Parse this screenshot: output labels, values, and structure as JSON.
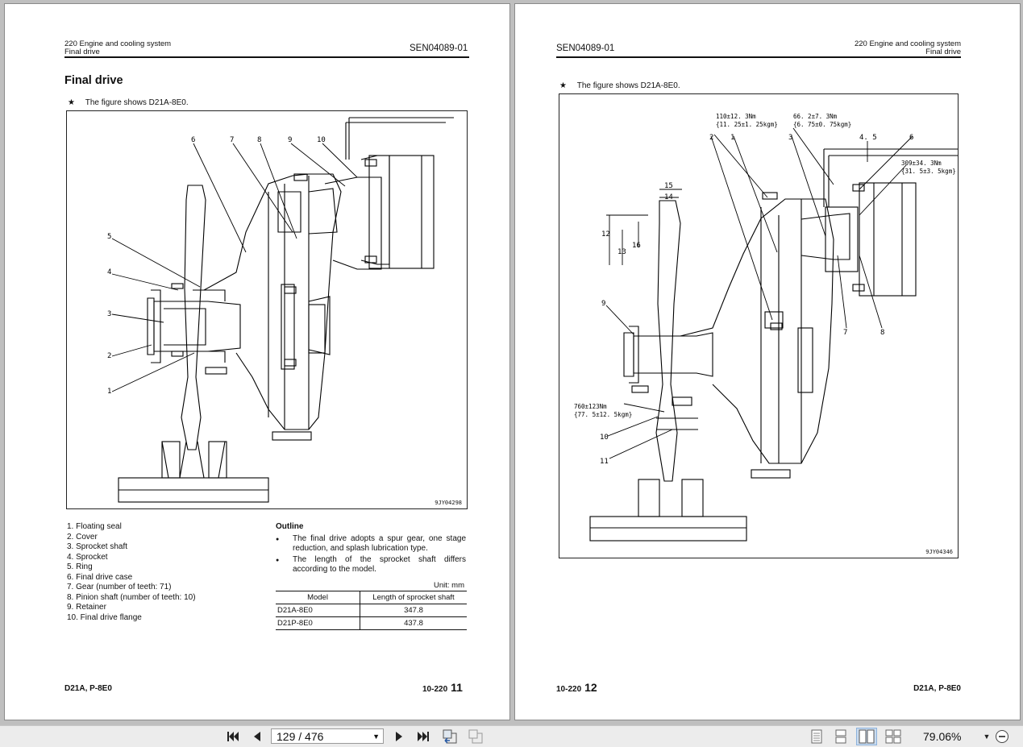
{
  "left_page": {
    "header_line1": "220 Engine and cooling system",
    "header_line2": "Final drive",
    "doc_code": "SEN04089-01",
    "title": "Final drive",
    "note_star": "★",
    "note": "The figure shows D21A-8E0.",
    "figure_id": "9JY04298",
    "callouts": [
      "6",
      "7",
      "8",
      "9",
      "10",
      "5",
      "4",
      "3",
      "2",
      "1"
    ],
    "parts": [
      "1. Floating seal",
      "2. Cover",
      "3. Sprocket shaft",
      "4. Sprocket",
      "5. Ring",
      "6. Final drive case",
      "7. Gear (number of teeth: 71)",
      "8. Pinion shaft (number of teeth: 10)",
      "9. Retainer",
      "10. Final drive flange"
    ],
    "outline_heading": "Outline",
    "outline_bullets": [
      "The final drive adopts a spur gear, one stage reduction, and splash lubrication type.",
      "The length of the sprocket shaft differs according to the model."
    ],
    "unit_label": "Unit: mm",
    "table_headers": [
      "Model",
      "Length of sprocket shaft"
    ],
    "table_rows": [
      [
        "D21A-8E0",
        "347.8"
      ],
      [
        "D21P-8E0",
        "437.8"
      ]
    ],
    "footer_model": "D21A, P-8E0",
    "footer_section": "10-220",
    "footer_page": "11"
  },
  "right_page": {
    "doc_code": "SEN04089-01",
    "header_line1": "220 Engine and cooling system",
    "header_line2": "Final drive",
    "note_star": "★",
    "note": "The figure shows D21A-8E0.",
    "figure_id": "9JY04346",
    "torque_labels": {
      "t1a": "110±12. 3Nm",
      "t1b": "{11. 25±1. 25kgm}",
      "t2a": "66. 2±7. 3Nm",
      "t2b": "{6. 75±0. 75kgm}",
      "t3a": "309±34. 3Nm",
      "t3b": "{31. 5±3. 5kgm}",
      "t4a": "760±123Nm",
      "t4b": "{77. 5±12. 5kgm}"
    },
    "callouts": [
      "2",
      "1",
      "3",
      "4. 5",
      "6",
      "15",
      "14",
      "12",
      "13",
      "16",
      "9",
      "7",
      "8",
      "10",
      "11"
    ],
    "footer_section": "10-220",
    "footer_page": "12",
    "footer_model": "D21A, P-8E0"
  },
  "toolbar": {
    "page_field": "129 / 476",
    "zoom": "79.06%",
    "icons": [
      "first-page-icon",
      "prev-page-icon",
      "next-page-icon",
      "last-page-icon",
      "go-back-icon",
      "go-forward-icon",
      "single-page-view-icon",
      "continuous-view-icon",
      "facing-view-icon",
      "continuous-facing-view-icon",
      "zoom-dropdown-icon",
      "zoom-out-icon"
    ]
  }
}
